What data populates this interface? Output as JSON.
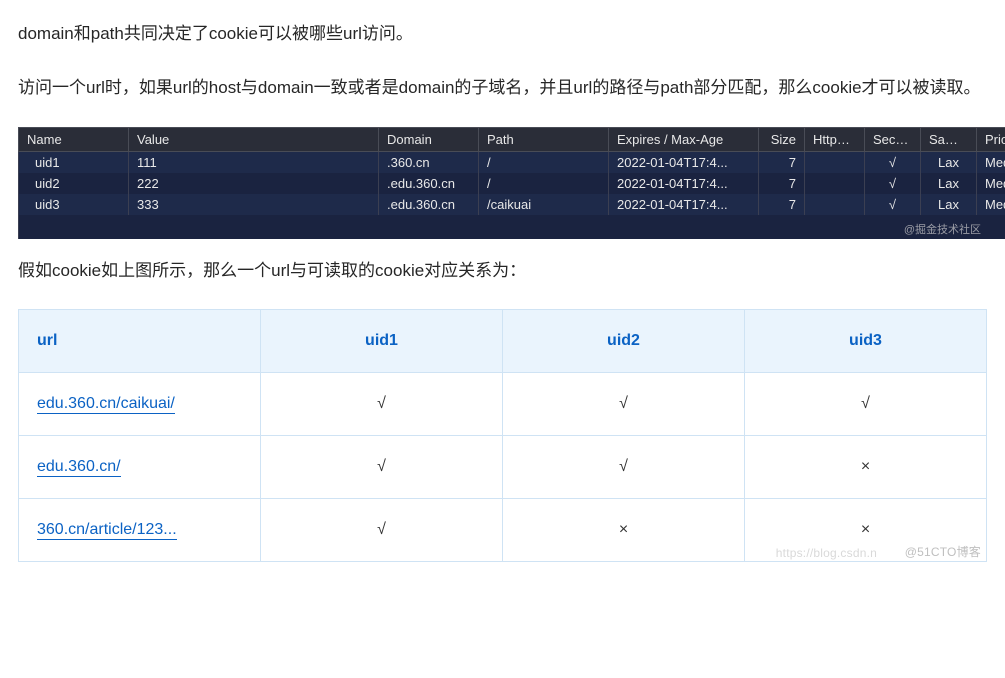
{
  "paragraphs": {
    "p1": "domain和path共同决定了cookie可以被哪些url访问。",
    "p2": "访问一个url时，如果url的host与domain一致或者是domain的子域名，并且url的路径与path部分匹配，那么cookie才可以被读取。",
    "p3": "假如cookie如上图所示，那么一个url与可读取的cookie对应关系为："
  },
  "devtools": {
    "headers": {
      "name": "Name",
      "value": "Value",
      "domain": "Domain",
      "path": "Path",
      "expires": "Expires / Max-Age",
      "size": "Size",
      "httponly": "HttpO...",
      "secure": "Secure",
      "samesite": "Same...",
      "priority": "Priority"
    },
    "rows": [
      {
        "name": "uid1",
        "value": "111",
        "domain": ".360.cn",
        "path": "/",
        "expires": "2022-01-04T17:4...",
        "size": "7",
        "httponly": "",
        "secure": "√",
        "samesite": "Lax",
        "priority": "Medium"
      },
      {
        "name": "uid2",
        "value": "222",
        "domain": ".edu.360.cn",
        "path": "/",
        "expires": "2022-01-04T17:4...",
        "size": "7",
        "httponly": "",
        "secure": "√",
        "samesite": "Lax",
        "priority": "Medium"
      },
      {
        "name": "uid3",
        "value": "333",
        "domain": ".edu.360.cn",
        "path": "/caikuai",
        "expires": "2022-01-04T17:4...",
        "size": "7",
        "httponly": "",
        "secure": "√",
        "samesite": "Lax",
        "priority": "Medium"
      }
    ],
    "watermark": "@掘金技术社区"
  },
  "maptable": {
    "headers": {
      "url": "url",
      "uid1": "uid1",
      "uid2": "uid2",
      "uid3": "uid3"
    },
    "rows": [
      {
        "url": "edu.360.cn/caikuai/",
        "uid1": "√",
        "uid2": "√",
        "uid3": "√"
      },
      {
        "url": "edu.360.cn/",
        "uid1": "√",
        "uid2": "√",
        "uid3": "×"
      },
      {
        "url": "360.cn/article/123...",
        "uid1": "√",
        "uid2": "×",
        "uid3": "×"
      }
    ],
    "watermark_left": "https://blog.csdn.n",
    "watermark_right": "@51CTO博客"
  }
}
